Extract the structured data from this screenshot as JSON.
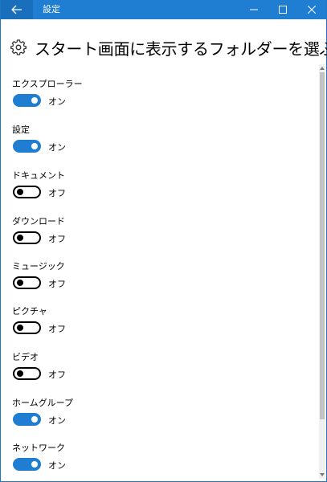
{
  "window": {
    "app_title": "設定",
    "accent_color": "#1f7ed2"
  },
  "caption_buttons": [
    "minimize-icon",
    "maximize-icon",
    "close-icon"
  ],
  "header": {
    "icon": "gear-icon",
    "title": "スタート画面に表示するフォルダーを選ぶ"
  },
  "settings": [
    {
      "label": "エクスプローラー",
      "on": true,
      "state": "オン"
    },
    {
      "label": "設定",
      "on": true,
      "state": "オン"
    },
    {
      "label": "ドキュメント",
      "on": false,
      "state": "オフ"
    },
    {
      "label": "ダウンロード",
      "on": false,
      "state": "オフ"
    },
    {
      "label": "ミュージック",
      "on": false,
      "state": "オフ"
    },
    {
      "label": "ピクチャ",
      "on": false,
      "state": "オフ"
    },
    {
      "label": "ビデオ",
      "on": false,
      "state": "オフ"
    },
    {
      "label": "ホームグループ",
      "on": true,
      "state": "オン"
    },
    {
      "label": "ネットワーク",
      "on": true,
      "state": "オン"
    }
  ]
}
